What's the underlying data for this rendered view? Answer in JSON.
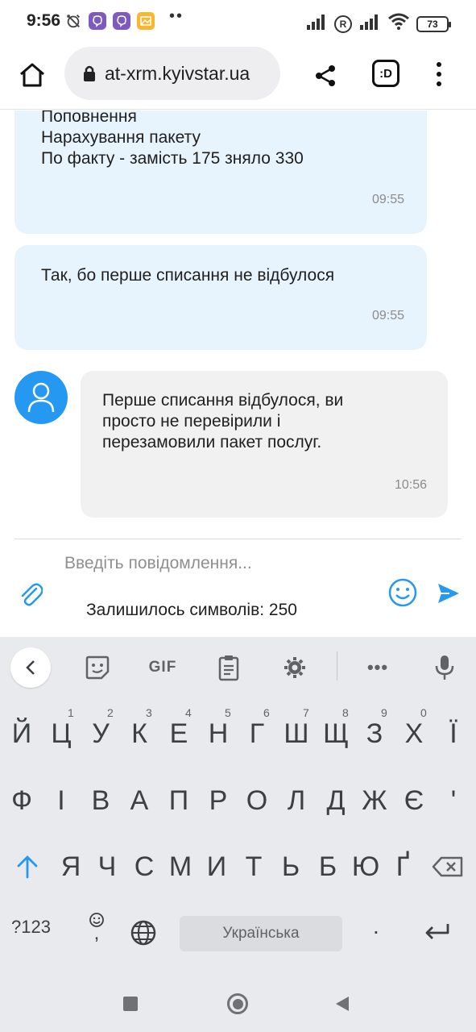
{
  "status_bar": {
    "time": "9:56",
    "dots": "••",
    "roaming_badge": "R",
    "battery": "73"
  },
  "browser": {
    "url": "at-xrm.kyivstar.ua",
    "tabs_label": ":D"
  },
  "chat": {
    "messages": [
      {
        "from": "user",
        "text": "Поповнення\nНарахування пакету\nПо факту - замість 175 зняло 330",
        "time": "09:55"
      },
      {
        "from": "user",
        "text": "Так, бо перше списання не відбулося",
        "time": "09:55"
      },
      {
        "from": "operator",
        "text": "Перше списання відбулося, ви\nпросто не перевірили і\nперезамовили пакет послуг.",
        "time": "10:56"
      }
    ]
  },
  "composer": {
    "placeholder": "Введіть повідомлення...",
    "value": "",
    "chars_left": "Залишилось символів: 250"
  },
  "keyboard": {
    "toolbar": {
      "gif_label": "GIF",
      "more_label": "•••"
    },
    "row1": [
      "Й",
      "Ц",
      "У",
      "К",
      "Е",
      "Н",
      "Г",
      "Ш",
      "Щ",
      "З",
      "Х",
      "Ї"
    ],
    "row1_hints": [
      "1",
      "2",
      "3",
      "4",
      "5",
      "6",
      "7",
      "8",
      "9",
      "0"
    ],
    "row2": [
      "Ф",
      "І",
      "В",
      "А",
      "П",
      "Р",
      "О",
      "Л",
      "Д",
      "Ж",
      "Є",
      "'"
    ],
    "row3": [
      "Я",
      "Ч",
      "С",
      "М",
      "И",
      "Т",
      "Ь",
      "Б",
      "Ю",
      "Ґ"
    ],
    "symbols_label": "?123",
    "comma_label": ",",
    "space_label": "Українська",
    "period_label": "."
  },
  "colors": {
    "accent": "#2599f2",
    "user_bubble": "#e8f4fd",
    "operator_bubble": "#f1f1f1",
    "keyboard_bg": "#e8eaed"
  }
}
